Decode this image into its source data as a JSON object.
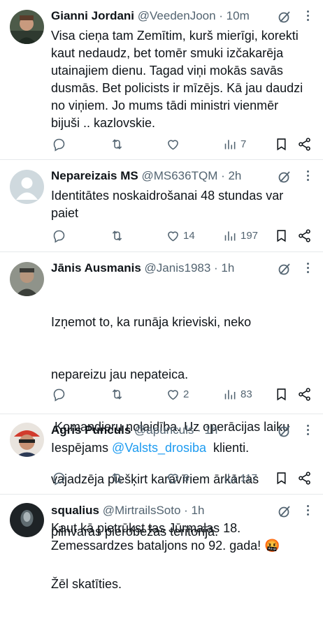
{
  "tweets": [
    {
      "name": "Gianni Jordani",
      "handle": "@VeedenJoon",
      "time": "· 10m",
      "text": "Visa cieņa tam Zemītim, kurš mierīgi, korekti kaut nedaudz, bet tomēr smuki izčakarēja utainajiem dienu. Tagad viņi mokās savās dusmās. Bet policists ir mīzējs. Kā jau daudzi no viņiem. Jo mums tādi ministri vienmēr bijuši .. kazlovskie.",
      "lines": [
        "Visa cieņa tam Zemītim, kurš mierīgi, korekti",
        "kaut nedaudz, bet tomēr smuki izčakarēja",
        "utainajiem dienu. Tagad viņi mokās savās",
        "dusmās. Bet policists ir mīzējs. Kā jau daudzi",
        "no viņiem. Jo mums tādi ministri vienmēr",
        "bijuši .. kazlovskie."
      ],
      "likes": "",
      "views": "7",
      "avatar_color": "#3a4a3e"
    },
    {
      "name": "Nepareizais MS",
      "handle": "@MS636TQM",
      "time": "· 2h",
      "lines": [
        "Identitātes noskaidrošanai 48 stundas var",
        "paiet"
      ],
      "likes": "14",
      "views": "197",
      "avatar_color": "#cfd9de"
    },
    {
      "name": "Jānis Ausmanis",
      "handle": "@Janis1983",
      "time": "· 1h",
      "lines": [
        "Izņemot to, ka runāja krieviski, neko",
        "nepareizu jau nepateica.",
        " Komandieru nolaidība. Uz operācijas laiku",
        "vajadzēja piešķirt karavīriem ārkārtas",
        "pilnvaras pierobežas teritorijā.",
        "Žēl skatīties."
      ],
      "likes": "2",
      "views": "83",
      "avatar_color": "#6b6f63"
    },
    {
      "name": "Agris Punculs",
      "handle": "@apunculs",
      "time": "· 1h",
      "text_before": "Iespējams ",
      "mention": "@Valsts_drosiba",
      "text_after": "  klienti.",
      "likes": "8",
      "views": "117",
      "avatar_color": "#d94a3a"
    },
    {
      "name": "squalius",
      "handle": "@MirtrailsSoto",
      "time": "· 1h",
      "lines": [
        "Kaut kā pietrūkst tas Jūrmalas 18.",
        "Zemessardzes bataljons no 92. gada! 🤬"
      ],
      "avatar_color": "#1e2326"
    }
  ],
  "icons": [
    "reply-icon",
    "retweet-icon",
    "like-icon",
    "views-icon",
    "bookmark-icon",
    "share-icon",
    "grok-icon",
    "more-icon"
  ],
  "colors": {
    "text": "#0f1419",
    "secondary": "#536471",
    "link": "#1d9bf0",
    "divider": "#e6e9eb"
  }
}
